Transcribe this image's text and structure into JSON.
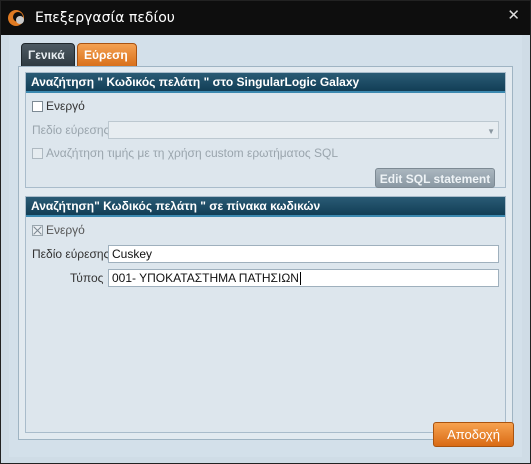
{
  "window": {
    "title": "Επεξεργασία πεδίου",
    "close_glyph": "✕",
    "app_icon": "app-logo-icon"
  },
  "tabs": [
    {
      "label": "Γενικά",
      "active": false
    },
    {
      "label": "Εύρεση",
      "active": true
    }
  ],
  "group1": {
    "header": "Αναζήτηση \" Κωδικός πελάτη \" στο SingularLogic Galaxy",
    "active_label": "Ενεργό",
    "active_checked": false,
    "field_label": "Πεδίο εύρεσης",
    "field_value": "",
    "custom_sql_label": "Αναζήτηση τιμής με τη χρήση custom ερωτήματος SQL",
    "custom_sql_checked": false,
    "edit_sql_button": "Edit SQL statement"
  },
  "group2": {
    "header": "Αναζήτηση\" Κωδικός πελάτη \" σε πίνακα κωδικών",
    "active_label": "Ενεργό",
    "active_checked": true,
    "field_label": "Πεδίο εύρεσης",
    "field_value": "Cuskey",
    "type_label": "Τύπος",
    "type_value": "001- ΥΠΟΚΑΤΑΣΤΗΜΑ ΠΑΤΗΣΙΩΝ"
  },
  "footer": {
    "accept_button": "Αποδοχή"
  },
  "colors": {
    "accent_orange": "#e07a22",
    "header_blue": "#1d4c66",
    "titlebar": "#0e0e0e"
  }
}
